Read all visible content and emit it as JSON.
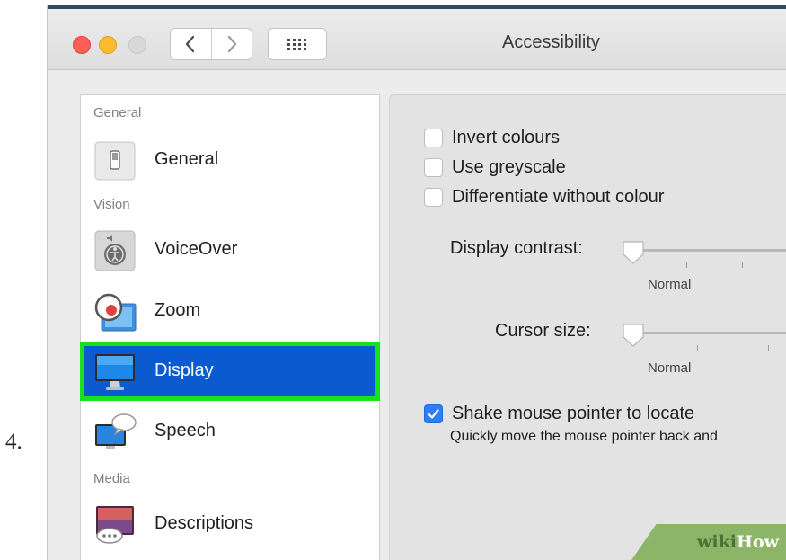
{
  "step_number": "4.",
  "window": {
    "title": "Accessibility"
  },
  "toolbar": {
    "back_icon": "chevron-left-icon",
    "forward_icon": "chevron-right-icon",
    "show_all_icon": "grid-icon"
  },
  "sidebar": {
    "sections": {
      "general": "General",
      "vision": "Vision",
      "media": "Media"
    },
    "items": [
      {
        "label": "General",
        "icon": "switch-icon"
      },
      {
        "label": "VoiceOver",
        "icon": "voiceover-icon"
      },
      {
        "label": "Zoom",
        "icon": "magnifier-icon"
      },
      {
        "label": "Display",
        "icon": "monitor-icon",
        "selected": true
      },
      {
        "label": "Speech",
        "icon": "speech-bubble-icon"
      },
      {
        "label": "Descriptions",
        "icon": "descriptions-icon"
      }
    ]
  },
  "display_settings": {
    "checkboxes": [
      {
        "label": "Invert colours",
        "checked": false
      },
      {
        "label": "Use greyscale",
        "checked": false
      },
      {
        "label": "Differentiate without colour",
        "checked": false
      }
    ],
    "contrast": {
      "label": "Display contrast:",
      "value_label": "Normal",
      "level": 0
    },
    "cursor": {
      "label": "Cursor size:",
      "value_label": "Normal",
      "level": 0
    },
    "shake": {
      "label": "Shake mouse pointer to locate",
      "checked": true,
      "description": "Quickly move the mouse pointer back and"
    }
  },
  "watermark": {
    "part1": "wiki",
    "part2": "How"
  },
  "colors": {
    "selection_blue": "#0b5ad0",
    "highlight_green": "#19e01d",
    "checkbox_blue": "#2d7ef7",
    "traffic_red": "#fc5f57",
    "traffic_yellow": "#fdbc2e"
  }
}
